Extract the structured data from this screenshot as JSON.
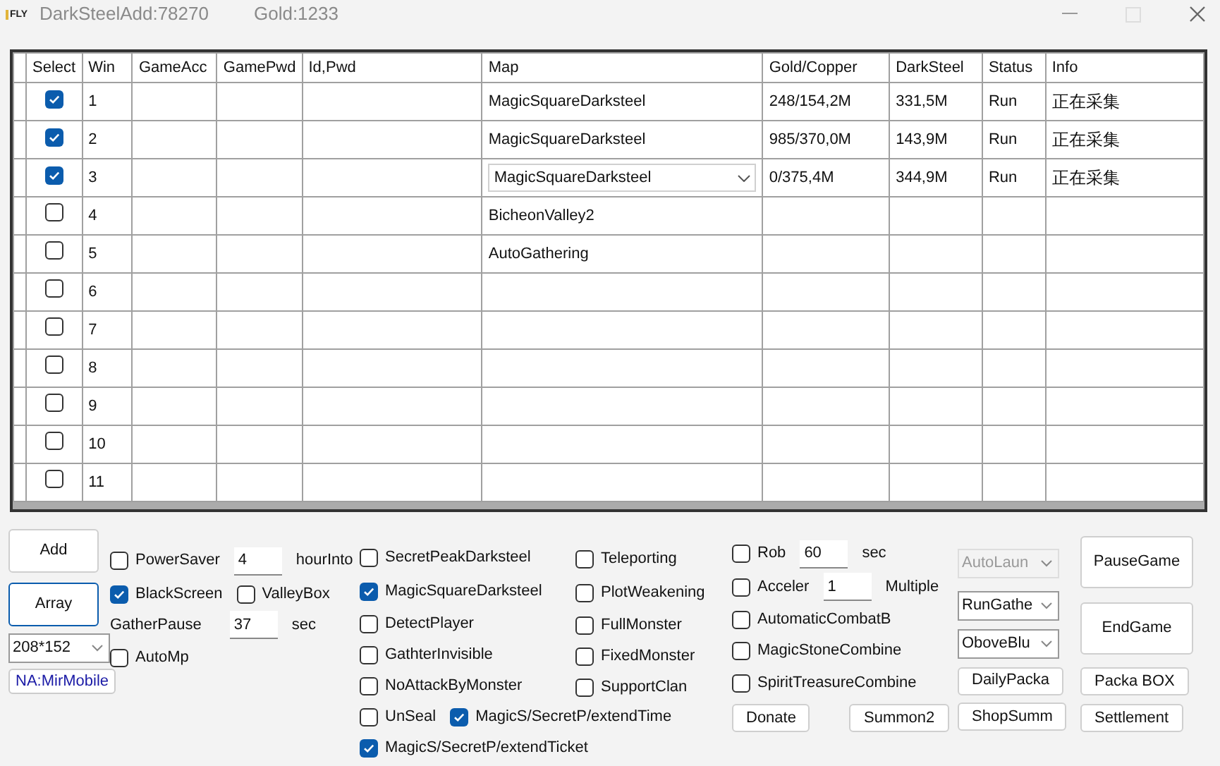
{
  "window": {
    "title": "DarkSteelAdd:78270",
    "gold": "Gold:1233",
    "logo": "FLY"
  },
  "table": {
    "columns": [
      "Select",
      "Win",
      "GameAcc",
      "GamePwd",
      "Id,Pwd",
      "Map",
      "Gold/Copper",
      "DarkSteel",
      "Status",
      "Info"
    ],
    "rows": [
      {
        "checked": true,
        "win": "1",
        "map": {
          "kind": "text",
          "text": "MagicSquareDarksteel"
        },
        "gold_copper": "248/154,2M",
        "dark_steel": "331,5M",
        "status": "Run",
        "info": "正在采集"
      },
      {
        "checked": true,
        "win": "2",
        "map": {
          "kind": "text",
          "text": "MagicSquareDarksteel"
        },
        "gold_copper": "985/370,0M",
        "dark_steel": "143,9M",
        "status": "Run",
        "info": "正在采集"
      },
      {
        "checked": true,
        "win": "3",
        "map": {
          "kind": "combo",
          "text": "MagicSquareDarksteel"
        },
        "gold_copper": "0/375,4M",
        "dark_steel": "344,9M",
        "status": "Run",
        "info": "正在采集"
      },
      {
        "checked": false,
        "win": "4",
        "map": {
          "kind": "text",
          "text": "BicheonValley2"
        }
      },
      {
        "checked": false,
        "win": "5",
        "map": {
          "kind": "text",
          "text": "AutoGathering"
        }
      },
      {
        "checked": false,
        "win": "6"
      },
      {
        "checked": false,
        "win": "7"
      },
      {
        "checked": false,
        "win": "8"
      },
      {
        "checked": false,
        "win": "9"
      },
      {
        "checked": false,
        "win": "10"
      },
      {
        "checked": false,
        "win": "11"
      }
    ]
  },
  "panel": {
    "columns": [
      {
        "controls": [
          {
            "items": [
              {
                "kind": "tall_button",
                "label": "Add",
                "focused": false
              }
            ]
          },
          {
            "items": [
              {
                "kind": "tall_button",
                "label": "Array",
                "focused": true
              }
            ]
          },
          {
            "items": [
              {
                "kind": "select",
                "value": "208*152",
                "disabled": false
              }
            ]
          },
          {
            "items": [
              {
                "kind": "tag",
                "text": "NA:MirMobile"
              }
            ]
          }
        ]
      },
      {
        "controls": [
          {
            "items": [
              {
                "kind": "check",
                "label": "PowerSaver",
                "checked": false
              },
              {
                "kind": "input",
                "value": "4"
              },
              {
                "kind": "text",
                "text": "hourInto"
              }
            ]
          },
          {
            "items": [
              {
                "kind": "check",
                "label": "BlackScreen",
                "checked": true
              },
              {
                "kind": "check",
                "label": "ValleyBox",
                "checked": false
              }
            ]
          },
          {
            "items": [
              {
                "kind": "text",
                "text": "GatherPause"
              },
              {
                "kind": "input",
                "value": "37"
              },
              {
                "kind": "text",
                "text": "sec"
              }
            ]
          },
          {
            "items": [
              {
                "kind": "check",
                "label": "AutoMp",
                "checked": false
              }
            ]
          }
        ]
      },
      {
        "controls": [
          {
            "items": [
              {
                "kind": "check",
                "label": "SecretPeakDarksteel",
                "checked": false
              }
            ]
          },
          {
            "items": [
              {
                "kind": "check",
                "label": "MagicSquareDarksteel",
                "checked": true
              }
            ]
          },
          {
            "items": [
              {
                "kind": "check",
                "label": "DetectPlayer",
                "checked": false
              }
            ]
          },
          {
            "items": [
              {
                "kind": "check",
                "label": "GathterInvisible",
                "checked": false
              }
            ]
          },
          {
            "items": [
              {
                "kind": "check",
                "label": "NoAttackByMonster",
                "checked": false
              }
            ]
          },
          {
            "items": [
              {
                "kind": "check",
                "label": "UnSeal",
                "checked": false
              },
              {
                "kind": "check",
                "label": "MagicS/SecretP/extendTime",
                "checked": true
              }
            ]
          },
          {
            "items": [
              {
                "kind": "check",
                "label": "MagicS/SecretP/extendTicket",
                "checked": true
              }
            ]
          }
        ]
      },
      {
        "controls": [
          {
            "items": [
              {
                "kind": "check",
                "label": "Teleporting",
                "checked": false
              }
            ]
          },
          {
            "items": [
              {
                "kind": "check",
                "label": "PlotWeakening",
                "checked": false
              }
            ]
          },
          {
            "items": [
              {
                "kind": "check",
                "label": "FullMonster",
                "checked": false
              }
            ]
          },
          {
            "items": [
              {
                "kind": "check",
                "label": "FixedMonster",
                "checked": false
              }
            ]
          },
          {
            "items": [
              {
                "kind": "check",
                "label": "SupportClan",
                "checked": false
              }
            ]
          }
        ]
      },
      {
        "controls": [
          {
            "items": [
              {
                "kind": "check",
                "label": "Rob",
                "checked": false
              },
              {
                "kind": "input",
                "value": "60"
              },
              {
                "kind": "text",
                "text": "sec"
              }
            ]
          },
          {
            "items": [
              {
                "kind": "check",
                "label": "Acceler",
                "checked": false
              },
              {
                "kind": "input",
                "value": "1"
              },
              {
                "kind": "text",
                "text": "Multiple"
              }
            ]
          },
          {
            "items": [
              {
                "kind": "check",
                "label": "AutomaticCombatB",
                "checked": false
              }
            ]
          },
          {
            "items": [
              {
                "kind": "check",
                "label": "MagicStoneCombine",
                "checked": false
              }
            ]
          },
          {
            "items": [
              {
                "kind": "check",
                "label": "SpiritTreasureCombine",
                "checked": false
              }
            ]
          },
          {
            "items": [
              {
                "kind": "small_button",
                "label": "Donate"
              },
              {
                "kind": "small_button",
                "label": "Summon2"
              }
            ]
          }
        ]
      },
      {
        "controls": [
          {
            "items": [
              {
                "kind": "select",
                "value": "AutoLaun",
                "disabled": true
              }
            ]
          },
          {
            "items": [
              {
                "kind": "select",
                "value": "RunGathe",
                "disabled": false
              }
            ]
          },
          {
            "items": [
              {
                "kind": "select",
                "value": "OboveBlu",
                "disabled": false
              }
            ]
          },
          {
            "items": [
              {
                "kind": "small_button",
                "label": "DailyPacka"
              }
            ]
          },
          {
            "items": [
              {
                "kind": "small_button",
                "label": "ShopSumm"
              }
            ]
          }
        ]
      },
      {
        "controls": [
          {
            "items": [
              {
                "kind": "big_button",
                "label": "PauseGame"
              }
            ]
          },
          {
            "items": [
              {
                "kind": "big_button",
                "label": "EndGame"
              }
            ]
          },
          {
            "items": [
              {
                "kind": "small_button",
                "label": "Packa BOX"
              }
            ]
          },
          {
            "items": [
              {
                "kind": "small_button",
                "label": "Settlement"
              }
            ]
          }
        ]
      }
    ]
  }
}
